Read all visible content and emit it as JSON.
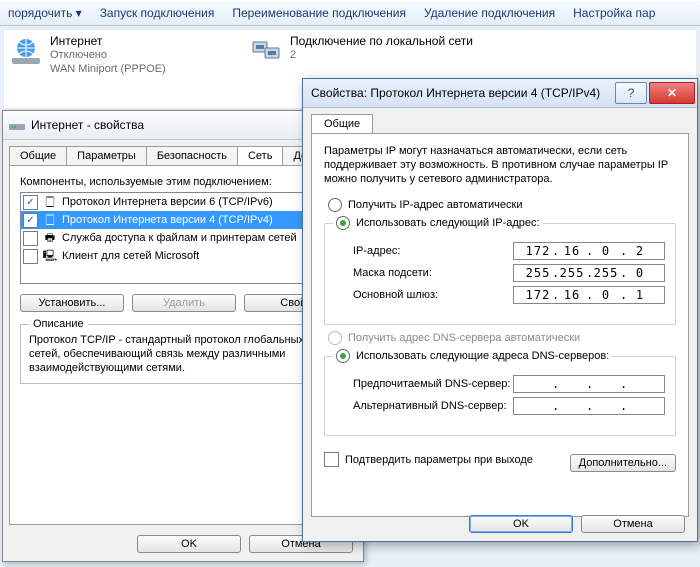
{
  "toolbar": {
    "items": [
      "порядочить ▾",
      "Запуск подключения",
      "Переименование подключения",
      "Удаление подключения",
      "Настройка пар"
    ]
  },
  "connections": [
    {
      "title": "Интернет",
      "status": "Отключено",
      "device": "WAN Miniport (PPPOE)",
      "icon": "globe"
    },
    {
      "title": "Подключение по локальной сети",
      "status": "2",
      "device": "",
      "icon": "lan"
    }
  ],
  "propDialog": {
    "title": "Интернет - свойства",
    "tabs": [
      "Общие",
      "Параметры",
      "Безопасность",
      "Сеть",
      "Доступ"
    ],
    "selectedTab": "Сеть",
    "componentsLabel": "Компоненты, используемые этим подключением:",
    "components": [
      {
        "checked": true,
        "selected": false,
        "icon": "proto",
        "label": "Протокол Интернета версии 6 (TCP/IPv6)"
      },
      {
        "checked": true,
        "selected": true,
        "icon": "proto",
        "label": "Протокол Интернета версии 4 (TCP/IPv4)"
      },
      {
        "checked": false,
        "selected": false,
        "icon": "share",
        "label": "Служба доступа к файлам и принтерам сетей"
      },
      {
        "checked": false,
        "selected": false,
        "icon": "client",
        "label": "Клиент для сетей Microsoft"
      }
    ],
    "buttons": {
      "install": "Установить...",
      "uninstall": "Удалить",
      "props": "Свойс"
    },
    "descHeader": "Описание",
    "descText": "Протокол TCP/IP - стандартный протокол глобальных сетей, обеспечивающий связь между различными взаимодействующими сетями.",
    "ok": "OK",
    "cancel": "Отмена"
  },
  "ipv4": {
    "title": "Свойства: Протокол Интернета версии 4 (TCP/IPv4)",
    "tab": "Общие",
    "paragraph": "Параметры IP могут назначаться автоматически, если сеть поддерживает эту возможность. В противном случае параметры IP можно получить у сетевого администратора.",
    "radio_auto_ip": "Получить IP-адрес автоматически",
    "radio_manual_ip": "Использовать следующий IP-адрес:",
    "lbl_ip": "IP-адрес:",
    "lbl_mask": "Маска подсети:",
    "lbl_gw": "Основной шлюз:",
    "ip": [
      "172",
      "16",
      "0",
      "2"
    ],
    "mask": [
      "255",
      "255",
      "255",
      "0"
    ],
    "gw": [
      "172",
      "16",
      "0",
      "1"
    ],
    "radio_auto_dns": "Получить адрес DNS-сервера автоматически",
    "radio_manual_dns": "Использовать следующие адреса DNS-серверов:",
    "lbl_dns1": "Предпочитаемый DNS-сервер:",
    "lbl_dns2": "Альтернативный DNS-сервер:",
    "dns1": [
      "",
      "",
      "",
      ""
    ],
    "dns2": [
      "",
      "",
      "",
      ""
    ],
    "confirm": "Подтвердить параметры при выходе",
    "advanced": "Дополнительно...",
    "ok": "OK",
    "cancel": "Отмена"
  }
}
